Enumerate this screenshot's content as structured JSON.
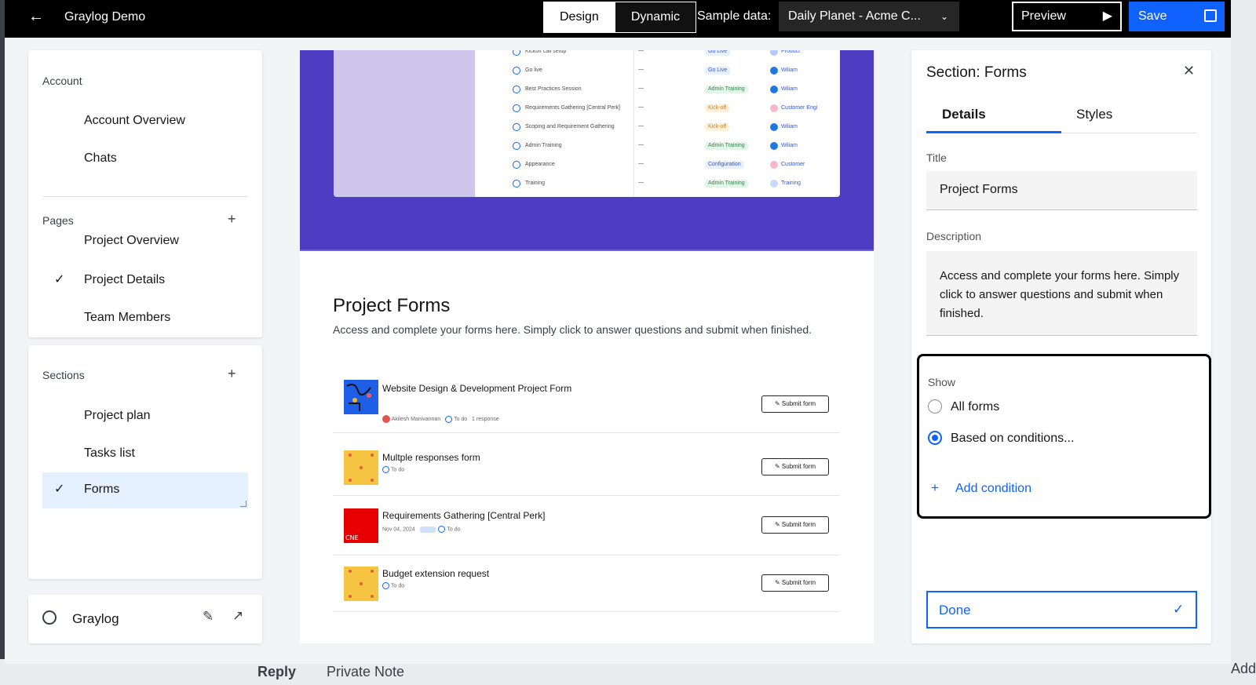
{
  "topbar": {
    "back_icon": "arrow-left-icon",
    "app_title": "Graylog Demo",
    "mode_tabs": [
      "Design",
      "Dynamic"
    ],
    "active_mode": "Design",
    "sample_label": "Sample data:",
    "sample_value": "Daily Planet - Acme C...",
    "preview_label": "Preview",
    "save_label": "Save"
  },
  "sidebar": {
    "account_label": "Account",
    "account_items": [
      "Account Overview",
      "Chats"
    ],
    "pages_label": "Pages",
    "pages_clipped": "Project Overview",
    "pages_items": [
      "Project Details",
      "Team Members"
    ],
    "pages_selected": "Project Details",
    "sections_label": "Sections",
    "sections_items": [
      "Project plan",
      "Tasks list",
      "Forms"
    ],
    "sections_selected": "Forms"
  },
  "workspace": {
    "name": "Graylog"
  },
  "canvas": {
    "mini_table": [
      {
        "name": "Kickoff call setup",
        "tag": "Go Live",
        "tag_color": "#e8f0fe",
        "tag_text": "#3156d3",
        "person": "Product",
        "ava": "#b7c7ff"
      },
      {
        "name": "Go live",
        "tag": "Go Live",
        "tag_color": "#e8f0fe",
        "tag_text": "#3156d3",
        "person": "Wiliam",
        "ava": "#1f7ae0"
      },
      {
        "name": "Best Practices Session",
        "tag": "Admin Training",
        "tag_color": "#e3f5e8",
        "tag_text": "#2e8b47",
        "person": "Wiliam",
        "ava": "#1f7ae0"
      },
      {
        "name": "Requirements Gathering [Central Perk]",
        "tag": "Kick-off",
        "tag_color": "#fdf1dc",
        "tag_text": "#c9822f",
        "person": "Customer Engi",
        "ava": "#f7b7c8"
      },
      {
        "name": "Scoping and Requirement Gathering",
        "tag": "Kick-off",
        "tag_color": "#fdf1dc",
        "tag_text": "#c9822f",
        "person": "Wiliam",
        "ava": "#1f7ae0"
      },
      {
        "name": "Admin Training",
        "tag": "Admin Training",
        "tag_color": "#e3f5e8",
        "tag_text": "#2e8b47",
        "person": "Wiliam",
        "ava": "#1f7ae0"
      },
      {
        "name": "Appearance",
        "tag": "Configuration",
        "tag_color": "#e8f0fe",
        "tag_text": "#3156d3",
        "person": "Customer",
        "ava": "#f7b7c8"
      },
      {
        "name": "Training",
        "tag": "Admin Training",
        "tag_color": "#e3f5e8",
        "tag_text": "#2e8b47",
        "person": "Training",
        "ava": "#c9d9ff"
      }
    ],
    "section_title": "Project Forms",
    "section_desc": "Access and complete your forms here. Simply click to answer questions and submit when finished.",
    "forms": [
      {
        "name": "Website Design & Development Project Form",
        "meta": [
          "Akilesh Manivannan",
          "To do",
          "1 response"
        ],
        "submit": "Submit form"
      },
      {
        "name": "Multple responses form",
        "meta": [
          "To do"
        ],
        "submit": "Submit form"
      },
      {
        "name": "Requirements Gathering [Central Perk]",
        "meta": [
          "Nov 04, 2024",
          "To do"
        ],
        "submit": "Submit form"
      },
      {
        "name": "Budget extension request",
        "meta": [
          "To do"
        ],
        "submit": "Submit form"
      }
    ]
  },
  "right_panel": {
    "title": "Section: Forms",
    "tabs": [
      "Details",
      "Styles"
    ],
    "active_tab": "Details",
    "title_label": "Title",
    "title_value": "Project Forms",
    "desc_label": "Description",
    "desc_value": "Access and complete your forms here. Simply click to answer questions and submit when finished.",
    "show_label": "Show",
    "show_options": [
      "All forms",
      "Based on conditions..."
    ],
    "show_selected": "Based on conditions...",
    "add_condition": "Add condition",
    "done_label": "Done"
  },
  "background": {
    "reply": "Reply",
    "private_note": "Private Note",
    "add": "Add"
  },
  "colors": {
    "accent": "#0f62fe",
    "hero": "#4e3cc3",
    "hero_lavender": "#cfc6ec",
    "topbar": "#000000"
  }
}
